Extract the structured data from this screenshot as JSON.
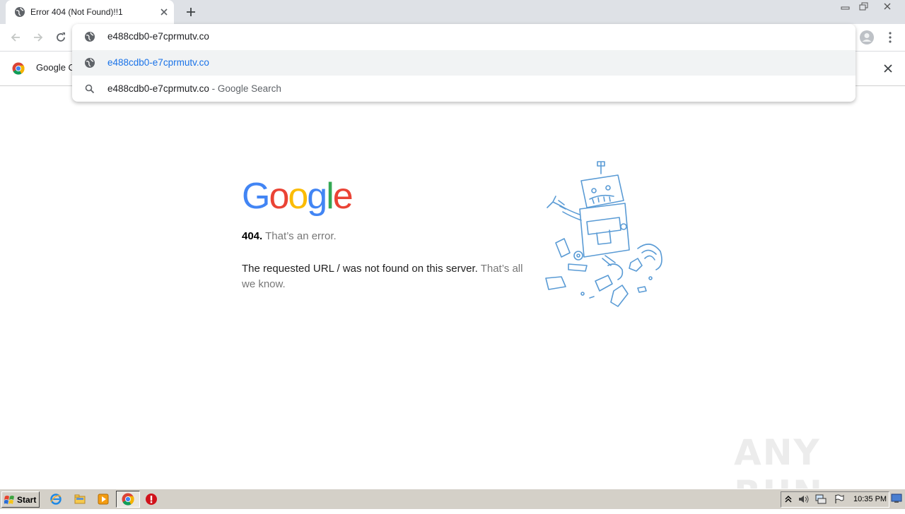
{
  "browser": {
    "tab": {
      "title": "Error 404 (Not Found)!!1"
    },
    "infobar": {
      "text": "Google Chrome"
    }
  },
  "omnibox": {
    "input_value": "e488cdb0-e7cprmutv.co",
    "suggestions": [
      {
        "text": "e488cdb0-e7cprmutv.co",
        "suffix": "",
        "icon": "globe-icon"
      },
      {
        "text": "e488cdb0-e7cprmutv.co",
        "suffix": " - Google Search",
        "icon": "search-icon"
      }
    ]
  },
  "page": {
    "logo_letters": [
      "G",
      "o",
      "o",
      "g",
      "l",
      "e"
    ],
    "logo_colors": [
      "#4285f4",
      "#ea4335",
      "#fbbc05",
      "#4285f4",
      "#34a853",
      "#ea4335"
    ],
    "error_code": "404.",
    "error_short": "That’s an error.",
    "error_message": "The requested URL / was not found on this server.",
    "error_soft": "That’s all we know."
  },
  "watermark": "ANY RUN",
  "taskbar": {
    "start_label": "Start",
    "clock": "10:35 PM"
  }
}
